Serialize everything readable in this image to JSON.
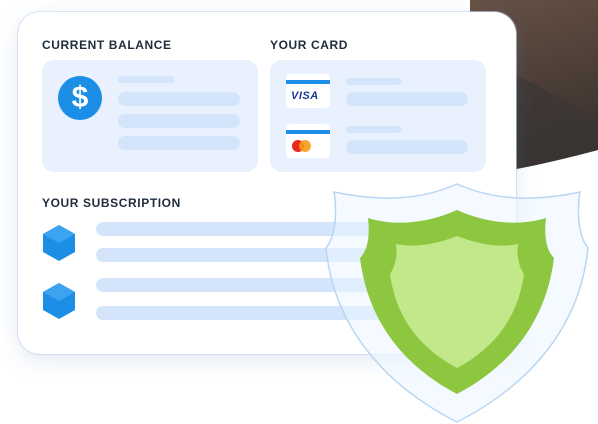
{
  "balance": {
    "title": "CURRENT BALANCE",
    "icon": "dollar-icon",
    "symbol": "$"
  },
  "card": {
    "title": "YOUR CARD",
    "items": [
      {
        "icon": "visa-card-icon",
        "brand": "VISA"
      },
      {
        "icon": "mastercard-icon",
        "brand": ""
      }
    ]
  },
  "subscription": {
    "title": "YOUR SUBSCRIPTION",
    "item_icon": "cube-icon"
  },
  "shield": {
    "icon": "shield-icon"
  },
  "colors": {
    "accent": "#1d8ee6",
    "shield_green": "#8dc63f",
    "shield_light": "#c2e889",
    "panel": "#e8f1fd"
  }
}
